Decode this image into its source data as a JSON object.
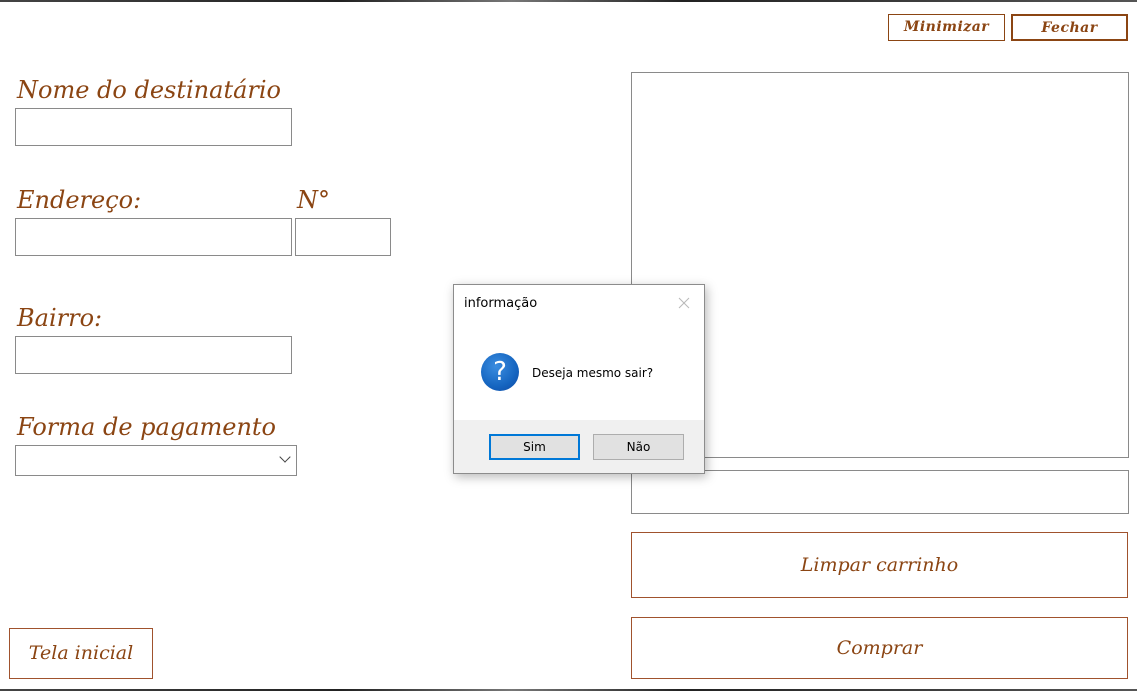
{
  "window": {
    "minimize_label": "Minimizar",
    "close_label": "Fechar"
  },
  "form": {
    "recipient_label": "Nome do destinatário",
    "recipient_value": "",
    "address_label": "Endereço:",
    "address_value": "",
    "number_label": "N°",
    "number_value": "",
    "district_label": "Bairro:",
    "district_value": "",
    "payment_label": "Forma de pagamento",
    "payment_selected": ""
  },
  "cart": {
    "total_value": "",
    "clear_label": "Limpar carrinho",
    "buy_label": "Comprar"
  },
  "nav": {
    "home_label": "Tela inicial"
  },
  "dialog": {
    "title": "informação",
    "message": "Deseja mesmo sair?",
    "icon": "question-icon",
    "yes_label": "Sim",
    "no_label": "Não"
  },
  "colors": {
    "accent": "#8b4513",
    "dialog_default_border": "#0078d7"
  }
}
